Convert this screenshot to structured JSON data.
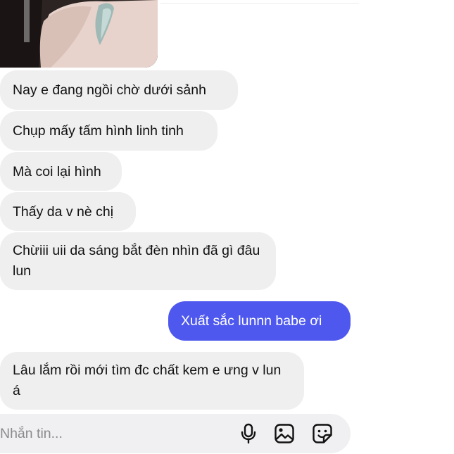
{
  "messages": [
    {
      "sender": "other",
      "text": "Nay e đang ngồi chờ dưới sảnh"
    },
    {
      "sender": "other",
      "text": "Chụp mấy tấm hình linh tinh"
    },
    {
      "sender": "other",
      "text": "Mà coi lại hình"
    },
    {
      "sender": "other",
      "text": "Thấy da v nè chị"
    },
    {
      "sender": "other",
      "text": "Chừiii uii da sáng bắt đèn nhìn đã gì đâu lun"
    },
    {
      "sender": "me",
      "text": "Xuất sắc lunnn babe ơi"
    },
    {
      "sender": "other",
      "text": "Lâu lắm rồi mới tìm đc chất kem e ưng v lun á"
    }
  ],
  "composer": {
    "placeholder": "Nhắn tin...",
    "icons": [
      "microphone-icon",
      "gallery-icon",
      "sticker-icon"
    ]
  },
  "colors": {
    "incoming_bubble": "#efeff0",
    "outgoing_bubble": "#4e58ee",
    "composer_bg": "#f0f0f2",
    "placeholder_text": "#8a8a8e"
  }
}
